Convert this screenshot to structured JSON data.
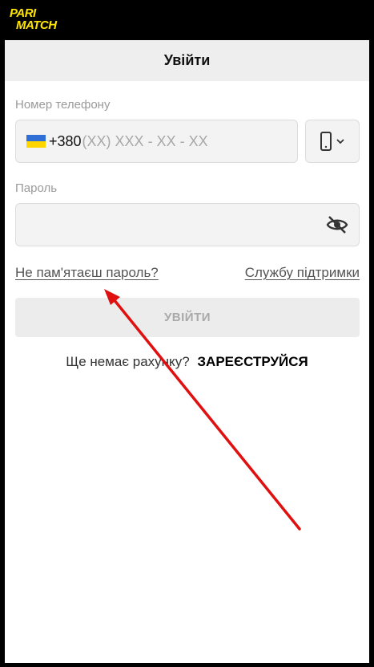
{
  "brand": {
    "line1": "PARI",
    "line2": "MATCH",
    "color": "#ffe600"
  },
  "header": {
    "title": "Увійти"
  },
  "phone": {
    "label": "Номер телефону",
    "country_code": "+380",
    "placeholder": "(XX) XXX - XX - XX",
    "flag_icon": "ukraine-flag-icon",
    "device_icon": "smartphone-icon"
  },
  "password": {
    "label": "Пароль",
    "toggle_icon": "eye-off-icon"
  },
  "links": {
    "forgot": "Не пам'ятаєш пароль?",
    "support": "Службу підтримки"
  },
  "login_button": {
    "label": "УВІЙТИ"
  },
  "register": {
    "prompt": "Ще немає рахунку?",
    "action": "ЗАРЕЄСТРУЙСЯ"
  },
  "annotation": {
    "color": "#e01010"
  }
}
